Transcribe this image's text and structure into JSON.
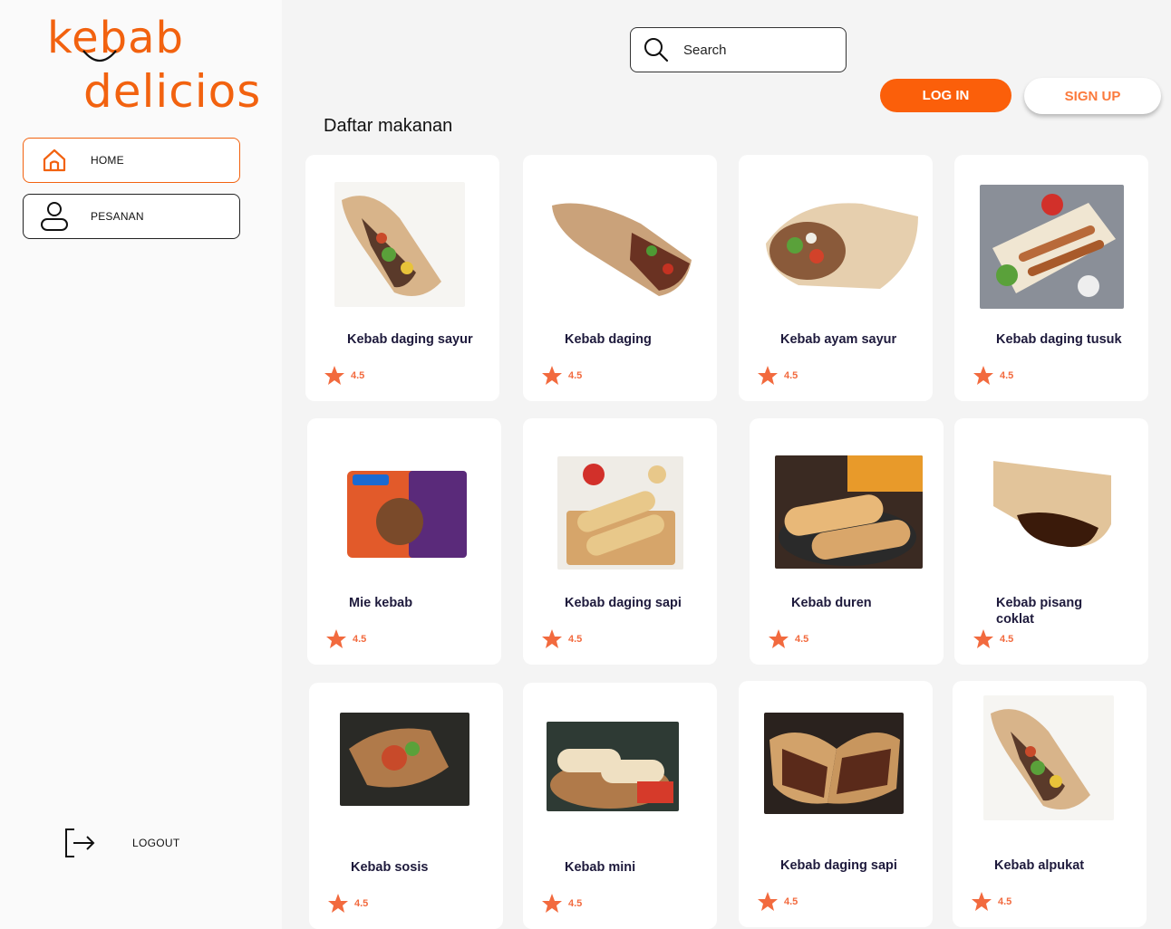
{
  "brand": {
    "line1": "kebab",
    "line2": "delicios",
    "color": "#f2620f"
  },
  "sidebar": {
    "items": [
      {
        "label": "HOME",
        "icon": "home-icon"
      },
      {
        "label": "PESANAN",
        "icon": "user-icon"
      }
    ],
    "logout_label": "LOGOUT"
  },
  "header": {
    "search_placeholder": "Search",
    "login_label": "LOG IN",
    "signup_label": "SIGN UP"
  },
  "section_title": "Daftar makanan",
  "menu": [
    {
      "name": "Kebab daging sayur",
      "rating": "4.5"
    },
    {
      "name": "Kebab daging",
      "rating": "4.5"
    },
    {
      "name": "Kebab ayam sayur",
      "rating": "4.5"
    },
    {
      "name": "Kebab daging tusuk",
      "rating": "4.5"
    },
    {
      "name": "Mie kebab",
      "rating": "4.5"
    },
    {
      "name": "Kebab daging sapi",
      "rating": "4.5"
    },
    {
      "name": "Kebab duren",
      "rating": "4.5"
    },
    {
      "name": "Kebab pisang coklat",
      "rating": "4.5"
    },
    {
      "name": "Kebab sosis",
      "rating": "4.5"
    },
    {
      "name": "Kebab mini",
      "rating": "4.5"
    },
    {
      "name": "Kebab daging sapi",
      "rating": "4.5"
    },
    {
      "name": "Kebab alpukat",
      "rating": "4.5"
    }
  ]
}
